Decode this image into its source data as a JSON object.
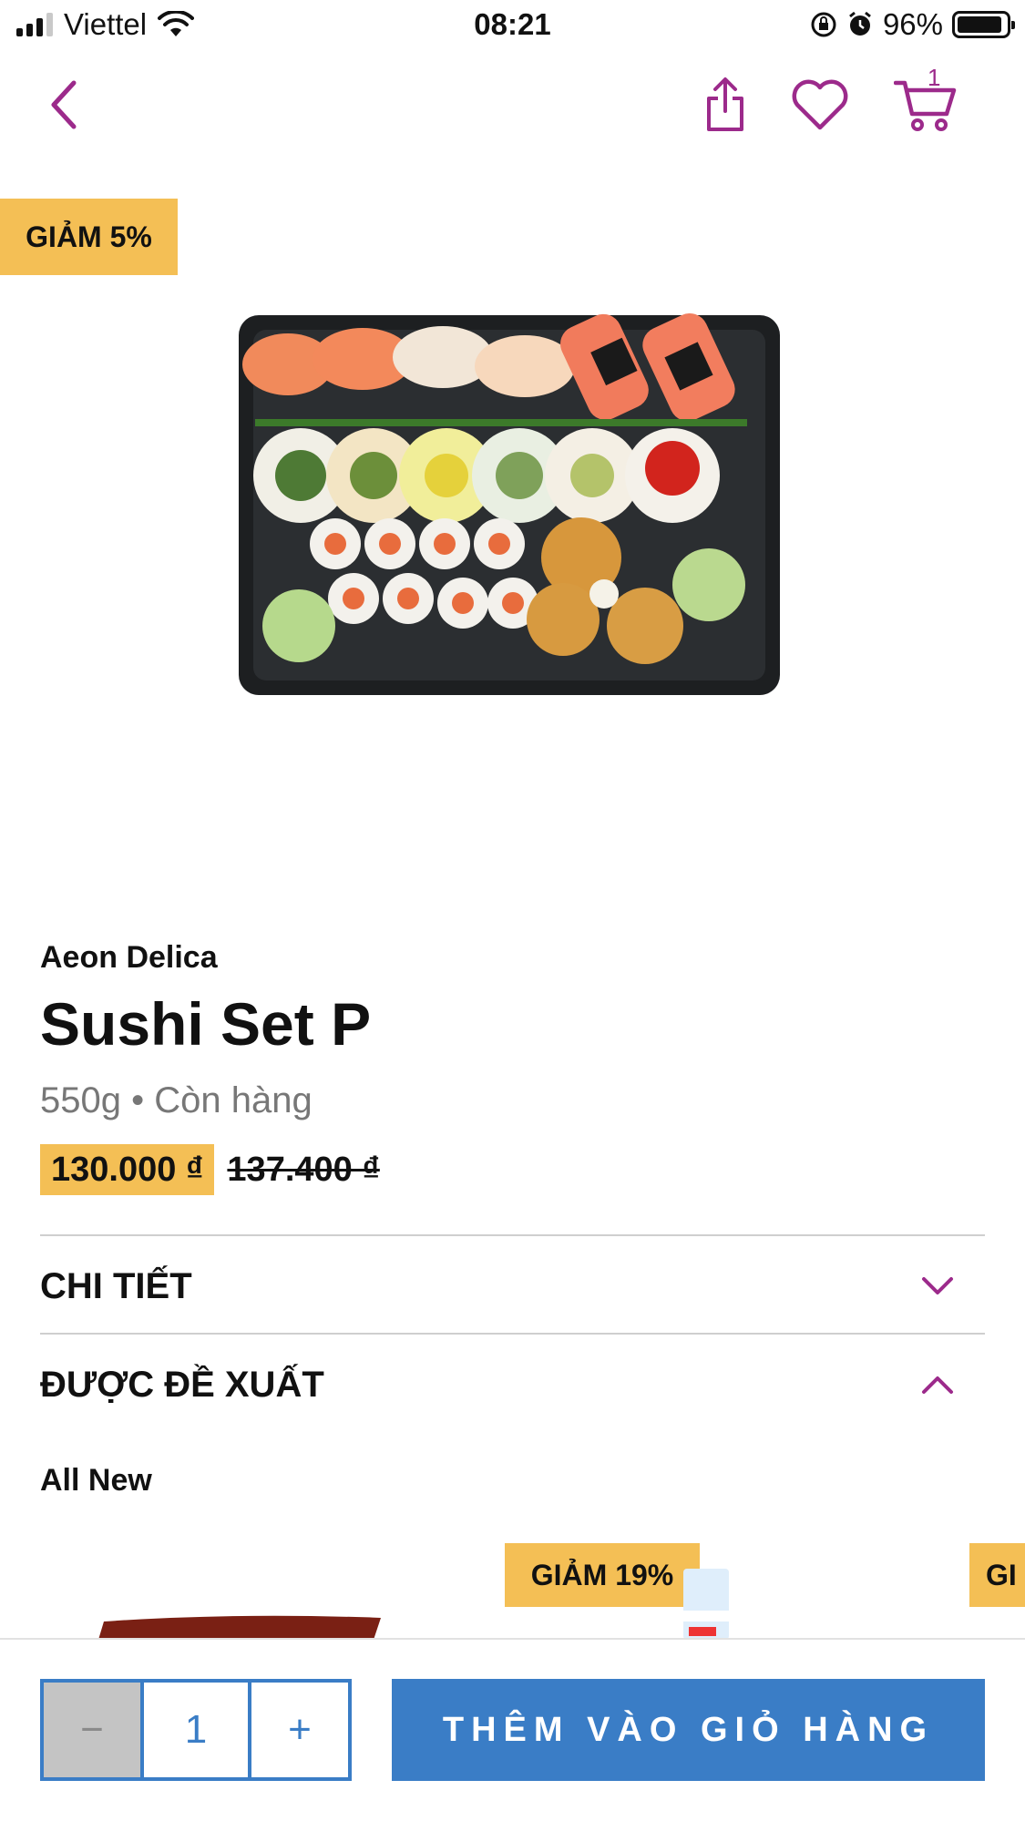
{
  "status_bar": {
    "carrier": "Viettel",
    "time": "08:21",
    "battery_percent": "96%"
  },
  "nav": {
    "cart_count": "1"
  },
  "product": {
    "discount_badge": "GIẢM 5%",
    "brand": "Aeon Delica",
    "name": "Sushi Set P",
    "weight_stock": "550g • Còn hàng",
    "price_sale": "130.000 ₫",
    "price_original": "137.400 ₫"
  },
  "sections": {
    "details_label": "CHI TIẾT",
    "recommended_label": "ĐƯỢC ĐỀ XUẤT"
  },
  "recommended": {
    "category": "All New",
    "items": [
      {
        "badge": ""
      },
      {
        "badge": "GIẢM 19%"
      },
      {
        "badge": "GI"
      }
    ]
  },
  "bottom_bar": {
    "quantity": "1",
    "minus": "−",
    "plus": "+",
    "add_to_cart": "THÊM VÀO GIỎ HÀNG"
  },
  "colors": {
    "accent_purple": "#9c2a8b",
    "badge_yellow": "#f4bf55",
    "primary_blue": "#3a7dc6"
  }
}
